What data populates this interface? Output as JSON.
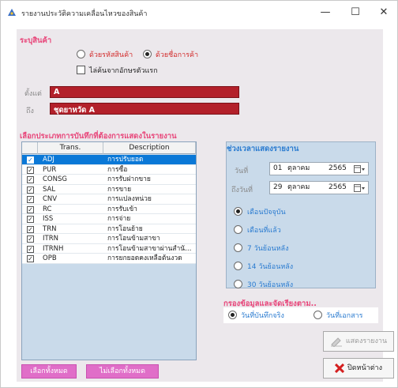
{
  "window": {
    "title": "รายงานประวัติความเคลื่อนไหวของสินค้า",
    "minimize": "—",
    "maximize": "☐",
    "close": "✕"
  },
  "product_spec": {
    "title": "ระบุสินค้า",
    "radio_by_code": "ด้วยรหัสสินค้า",
    "radio_by_name": "ด้วยชื่อการค้า",
    "selected": "by_name",
    "checkbox_first_letter": "ไล่ค้นจากอักษรตัวแรก",
    "from_label": "ตั้งแต่",
    "from_value": "A",
    "to_label": "ถึง",
    "to_value": "ชุดยาหวัด A"
  },
  "record_types": {
    "title": "เลือกประเภทการบันทึกที่ต้องการแสดงในรายงาน",
    "headers": {
      "trans": "Trans.",
      "desc": "Description"
    },
    "rows": [
      {
        "code": "ADJ",
        "desc": "การปรับยอด",
        "checked": true,
        "selected": true
      },
      {
        "code": "PUR",
        "desc": "การซื้อ",
        "checked": true,
        "selected": false
      },
      {
        "code": "CONSG",
        "desc": "การรับฝากขาย",
        "checked": true,
        "selected": false
      },
      {
        "code": "SAL",
        "desc": "การขาย",
        "checked": true,
        "selected": false
      },
      {
        "code": "CNV",
        "desc": "การแปลงหน่วย",
        "checked": true,
        "selected": false
      },
      {
        "code": "RC",
        "desc": "การรับเข้า",
        "checked": true,
        "selected": false
      },
      {
        "code": "ISS",
        "desc": "การจ่าย",
        "checked": true,
        "selected": false
      },
      {
        "code": "TRN",
        "desc": "การโอนย้าย",
        "checked": true,
        "selected": false
      },
      {
        "code": "ITRN",
        "desc": "การโอนข้ามสาขา",
        "checked": true,
        "selected": false
      },
      {
        "code": "ITRNH",
        "desc": "การโอนข้ามสาขาผ่านสำนักงานใ...",
        "checked": true,
        "selected": false
      },
      {
        "code": "OPB",
        "desc": "การยกยอดคงเหลือต้นงวด",
        "checked": true,
        "selected": false
      }
    ],
    "select_all": "เลือกทั้งหมด",
    "deselect_all": "ไม่เลือกทั้งหมด"
  },
  "period": {
    "title": "ช่วงเวลาแสดงรายงาน",
    "date_label": "วันที่",
    "date_day": "01",
    "date_month": "ตุลาคม",
    "date_year": "2565",
    "to_date_label": "ถึงวันที่",
    "to_day": "29",
    "to_month": "ตุลาคม",
    "to_year": "2565",
    "options": [
      "เดือนปัจจุบัน",
      "เดือนที่แล้ว",
      "7 วันย้อนหลัง",
      "14 วันย้อนหลัง",
      "30 วันย้อนหลัง"
    ],
    "selected_index": 0
  },
  "filter": {
    "title": "กรองข้อมูลและจัดเรียงตาม..",
    "opt_record_date": "วันที่บันทึกจริง",
    "opt_doc_date": "วันที่เอกสาร",
    "selected": "record_date"
  },
  "actions": {
    "show_report": "แสดงรายงาน",
    "close_window": "ปิดหน้าต่าง"
  }
}
